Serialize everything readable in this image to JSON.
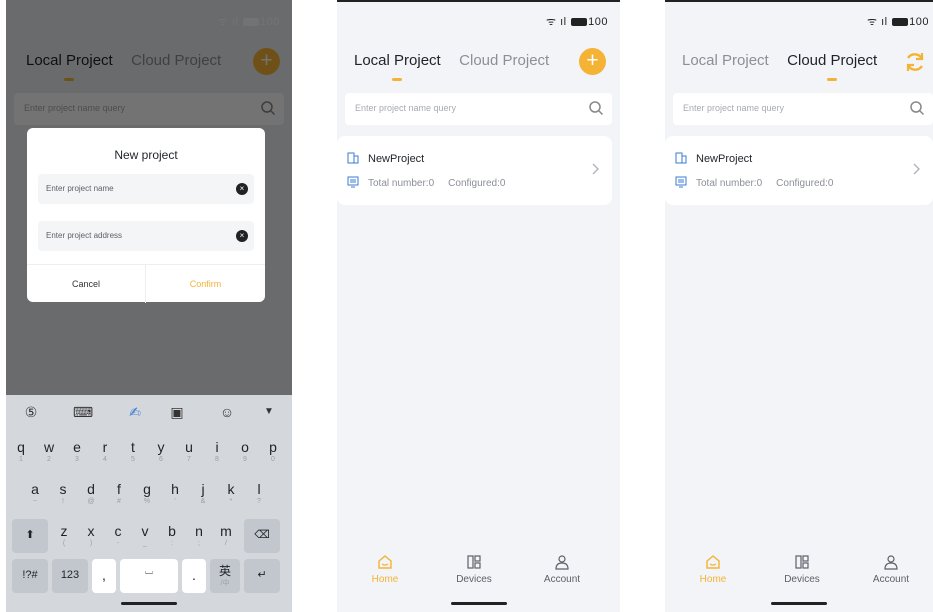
{
  "status": {
    "wifi": "ᯤ",
    "signal": "ıl",
    "battery": "100"
  },
  "tabs": {
    "local": "Local Project",
    "cloud": "Cloud Project"
  },
  "search": {
    "placeholder": "Enter project name query"
  },
  "project": {
    "name": "NewProject",
    "total": "Total number:0",
    "configured": "Configured:0"
  },
  "dialog": {
    "title": "New project",
    "name_placeholder": "Enter project name",
    "address_placeholder": "Enter project address",
    "cancel": "Cancel",
    "confirm": "Confirm"
  },
  "nav": {
    "home": "Home",
    "devices": "Devices",
    "account": "Account"
  },
  "keyboard": {
    "row1": [
      {
        "k": "q",
        "s": "1"
      },
      {
        "k": "w",
        "s": "2"
      },
      {
        "k": "e",
        "s": "3"
      },
      {
        "k": "r",
        "s": "4"
      },
      {
        "k": "t",
        "s": "5"
      },
      {
        "k": "y",
        "s": "6"
      },
      {
        "k": "u",
        "s": "7"
      },
      {
        "k": "i",
        "s": "8"
      },
      {
        "k": "o",
        "s": "9"
      },
      {
        "k": "p",
        "s": "0"
      }
    ],
    "row2": [
      {
        "k": "a",
        "s": "~"
      },
      {
        "k": "s",
        "s": "!"
      },
      {
        "k": "d",
        "s": "@"
      },
      {
        "k": "f",
        "s": "#"
      },
      {
        "k": "g",
        "s": "%"
      },
      {
        "k": "h",
        "s": "'"
      },
      {
        "k": "j",
        "s": "&"
      },
      {
        "k": "k",
        "s": "*"
      },
      {
        "k": "l",
        "s": "?"
      }
    ],
    "row3": [
      {
        "k": "z",
        "s": "("
      },
      {
        "k": "x",
        "s": ")"
      },
      {
        "k": "c",
        "s": "-"
      },
      {
        "k": "v",
        "s": "_"
      },
      {
        "k": "b",
        "s": ":"
      },
      {
        "k": "n",
        "s": ";"
      },
      {
        "k": "m",
        "s": "/"
      }
    ],
    "symbols": "!?#",
    "numbers": "123",
    "comma": ",",
    "period": ".",
    "lang": "英",
    "lang_sub": "/中"
  },
  "colors": {
    "accent": "#f5b335",
    "text": "#1f2329",
    "muted": "#8b8f97"
  }
}
